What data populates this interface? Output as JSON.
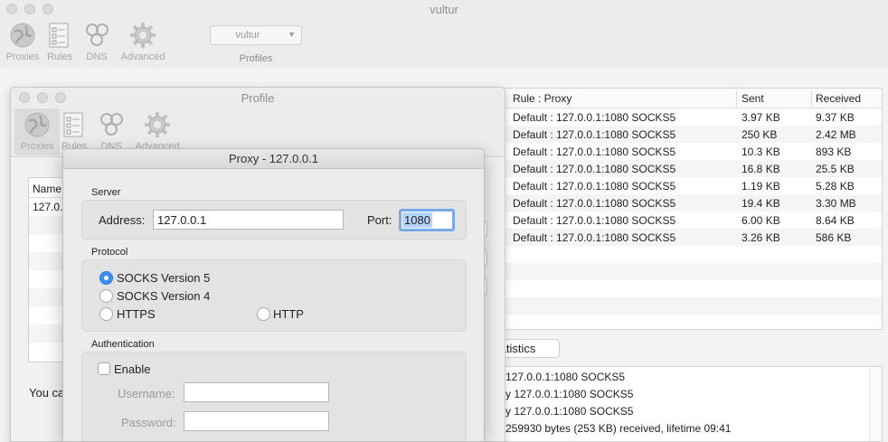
{
  "main_window": {
    "title": "vultur",
    "toolbar": {
      "proxies_label": "Proxies",
      "rules_label": "Rules",
      "dns_label": "DNS",
      "advanced_label": "Advanced",
      "profile_value": "vultur",
      "profiles_label": "Profiles"
    }
  },
  "connections": {
    "columns": {
      "rule_proxy": "Rule : Proxy",
      "sent": "Sent",
      "received": "Received"
    },
    "rows": [
      {
        "rule": "Default : 127.0.0.1:1080 SOCKS5",
        "sent": "3.97 KB",
        "received": "9.37 KB"
      },
      {
        "rule": "Default : 127.0.0.1:1080 SOCKS5",
        "sent": "250 KB",
        "received": "2.42 MB"
      },
      {
        "rule": "Default : 127.0.0.1:1080 SOCKS5",
        "sent": "10.3 KB",
        "received": "893 KB"
      },
      {
        "rule": "Default : 127.0.0.1:1080 SOCKS5",
        "sent": "16.8 KB",
        "received": "25.5 KB"
      },
      {
        "rule": "Default : 127.0.0.1:1080 SOCKS5",
        "sent": "1.19 KB",
        "received": "5.28 KB"
      },
      {
        "rule": "Default : 127.0.0.1:1080 SOCKS5",
        "sent": "19.4 KB",
        "received": "3.30 MB"
      },
      {
        "rule": "Default : 127.0.0.1:1080 SOCKS5",
        "sent": "6.00 KB",
        "received": "8.64 KB"
      },
      {
        "rule": "Default : 127.0.0.1:1080 SOCKS5",
        "sent": "3.26 KB",
        "received": "586 KB"
      }
    ]
  },
  "statistics_tab": "tatistics",
  "log": {
    "lines": [
      "127.0.0.1:1080 SOCKS5",
      "y 127.0.0.1:1080 SOCKS5",
      "y 127.0.0.1:1080 SOCKS5",
      "259930 bytes (253 KB) received, lifetime 09:41"
    ]
  },
  "profile_window": {
    "title": "Profile",
    "toolbar": {
      "proxies_label": "Proxies",
      "rules_label": "Rules",
      "dns_label": "DNS",
      "advanced_label": "Advanced"
    },
    "list_header": "Name",
    "list_rows": [
      "127.0."
    ],
    "notice": "You ca"
  },
  "proxy_dialog": {
    "title": "Proxy - 127.0.0.1",
    "server_label": "Server",
    "address_label": "Address:",
    "address_value": "127.0.0.1",
    "port_label": "Port:",
    "port_value": "1080",
    "protocol_label": "Protocol",
    "protocols": {
      "socks5": "SOCKS Version 5",
      "socks4": "SOCKS Version 4",
      "https": "HTTPS",
      "http": "HTTP"
    },
    "selected_protocol": "socks5",
    "authentication_label": "Authentication",
    "enable_label": "Enable",
    "enable_checked": false,
    "username_label": "Username:",
    "username_value": "",
    "password_label": "Password:",
    "password_value": ""
  },
  "colors": {
    "accent": "#3b8ef5",
    "selection": "#b3d4fd",
    "focus_ring": "#78a9ea"
  }
}
